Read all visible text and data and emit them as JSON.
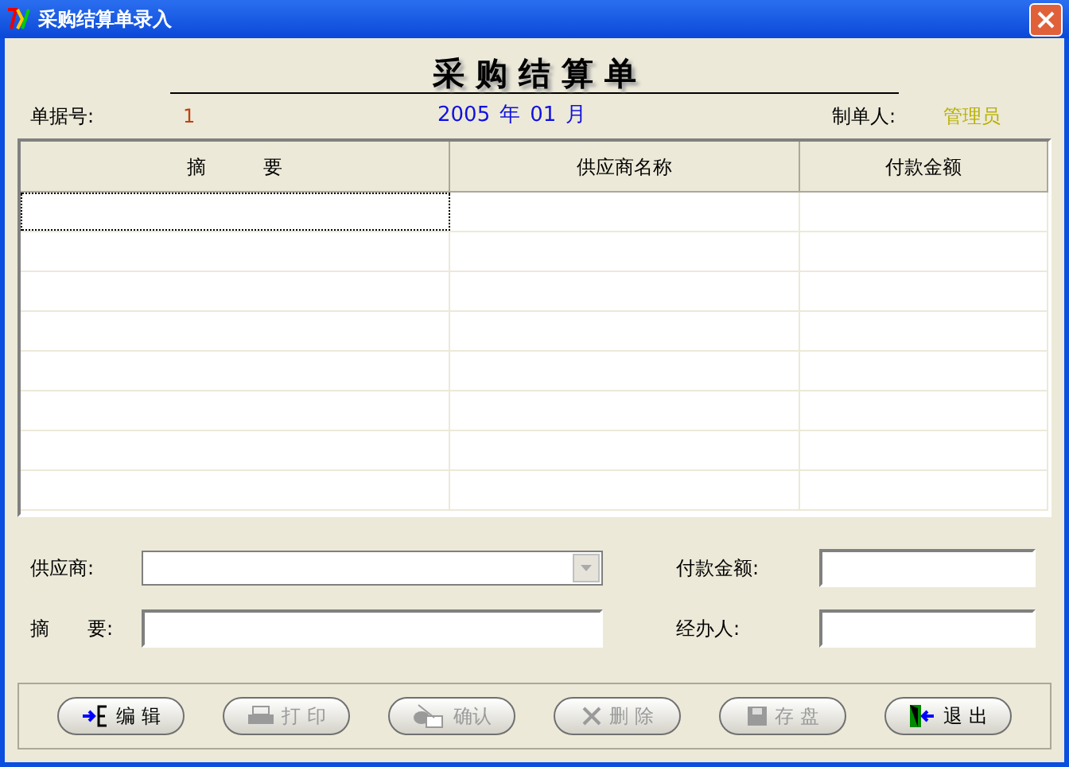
{
  "window": {
    "title": "采购结算单录入"
  },
  "heading": "采 购 结 算 单",
  "info": {
    "doc_no_label": "单据号:",
    "doc_no": "1",
    "year": "2005",
    "year_unit": "年",
    "month": "01",
    "month_unit": "月",
    "maker_label": "制单人:",
    "maker": "管理员"
  },
  "table": {
    "columns": [
      "摘　　　要",
      "供应商名称",
      "付款金额"
    ]
  },
  "form": {
    "supplier_label": "供应商:",
    "summary_label": "摘　　要:",
    "amount_label": "付款金额:",
    "handler_label": "经办人:"
  },
  "buttons": [
    {
      "label": "编 辑",
      "kind": "edit",
      "disabled": false
    },
    {
      "label": "打 印",
      "kind": "print",
      "disabled": true
    },
    {
      "label": "确认",
      "kind": "confirm",
      "disabled": true
    },
    {
      "label": "删 除",
      "kind": "delete",
      "disabled": true
    },
    {
      "label": "存 盘",
      "kind": "save",
      "disabled": true
    },
    {
      "label": "退 出",
      "kind": "exit",
      "disabled": false
    }
  ]
}
